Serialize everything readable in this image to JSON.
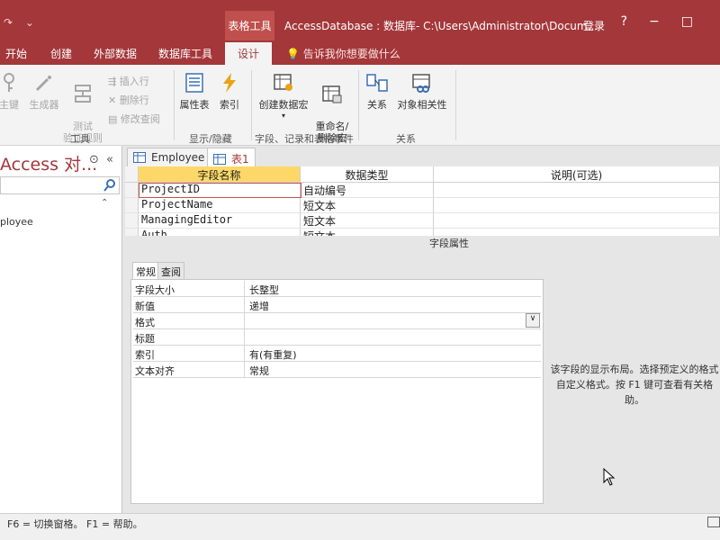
{
  "titlebar": {
    "context_group": "表格工具",
    "window_title": "AccessDatabase : 数据库- C:\\Users\\Administrator\\Docum...",
    "login": "登录"
  },
  "ribbon_tabs": [
    {
      "label": "开始"
    },
    {
      "label": "创建"
    },
    {
      "label": "外部数据"
    },
    {
      "label": "数据库工具"
    },
    {
      "label": "设计",
      "active": true
    }
  ],
  "tell_me": "告诉我你想要做什么",
  "ribbon": {
    "tools_group": {
      "label": "工具",
      "primary_key": "主键",
      "builder": "生成器",
      "test_rules": "测试\n验证规则",
      "insert_rows": "插入行",
      "delete_rows": "删除行",
      "modify_lookups": "修改查阅"
    },
    "show_hide_group": {
      "label": "显示/隐藏",
      "property_sheet": "属性表",
      "indexes": "索引"
    },
    "field_events_group": {
      "label": "字段、记录和表格事件",
      "create_macro": "创建数据宏",
      "rename_macro": "重命名/\n删除宏"
    },
    "relationships_group": {
      "label": "关系",
      "relationships": "关系",
      "dependencies": "对象相关性"
    }
  },
  "nav_pane": {
    "title": "Access 对...",
    "item": "ployee"
  },
  "doc_tabs": [
    {
      "label": "Employee"
    },
    {
      "label": "表1",
      "active": true
    }
  ],
  "design_grid": {
    "headers": [
      "字段名称",
      "数据类型",
      "说明(可选)"
    ],
    "rows": [
      {
        "name": "ProjectID",
        "type": "自动编号"
      },
      {
        "name": "ProjectName",
        "type": "短文本"
      },
      {
        "name": "ManagingEditor",
        "type": "短文本"
      },
      {
        "name": "Auth",
        "type": "短文本"
      }
    ]
  },
  "field_properties": {
    "title": "字段属性",
    "tabs": [
      "常规",
      "查阅"
    ],
    "rows": [
      {
        "label": "字段大小",
        "value": "长整型"
      },
      {
        "label": "新值",
        "value": "递增"
      },
      {
        "label": "格式",
        "value": ""
      },
      {
        "label": "标题",
        "value": ""
      },
      {
        "label": "索引",
        "value": "有(有重复)"
      },
      {
        "label": "文本对齐",
        "value": "常规"
      }
    ],
    "help_text": "该字段的显示布局。选择预定义的格式\n自定义格式。按 F1 键可查看有关格\n助。"
  },
  "status_bar": {
    "text": "F6 = 切换窗格。 F1 = 帮助。"
  },
  "colors": {
    "accent": "#a4373a",
    "context": "#c0504d"
  }
}
